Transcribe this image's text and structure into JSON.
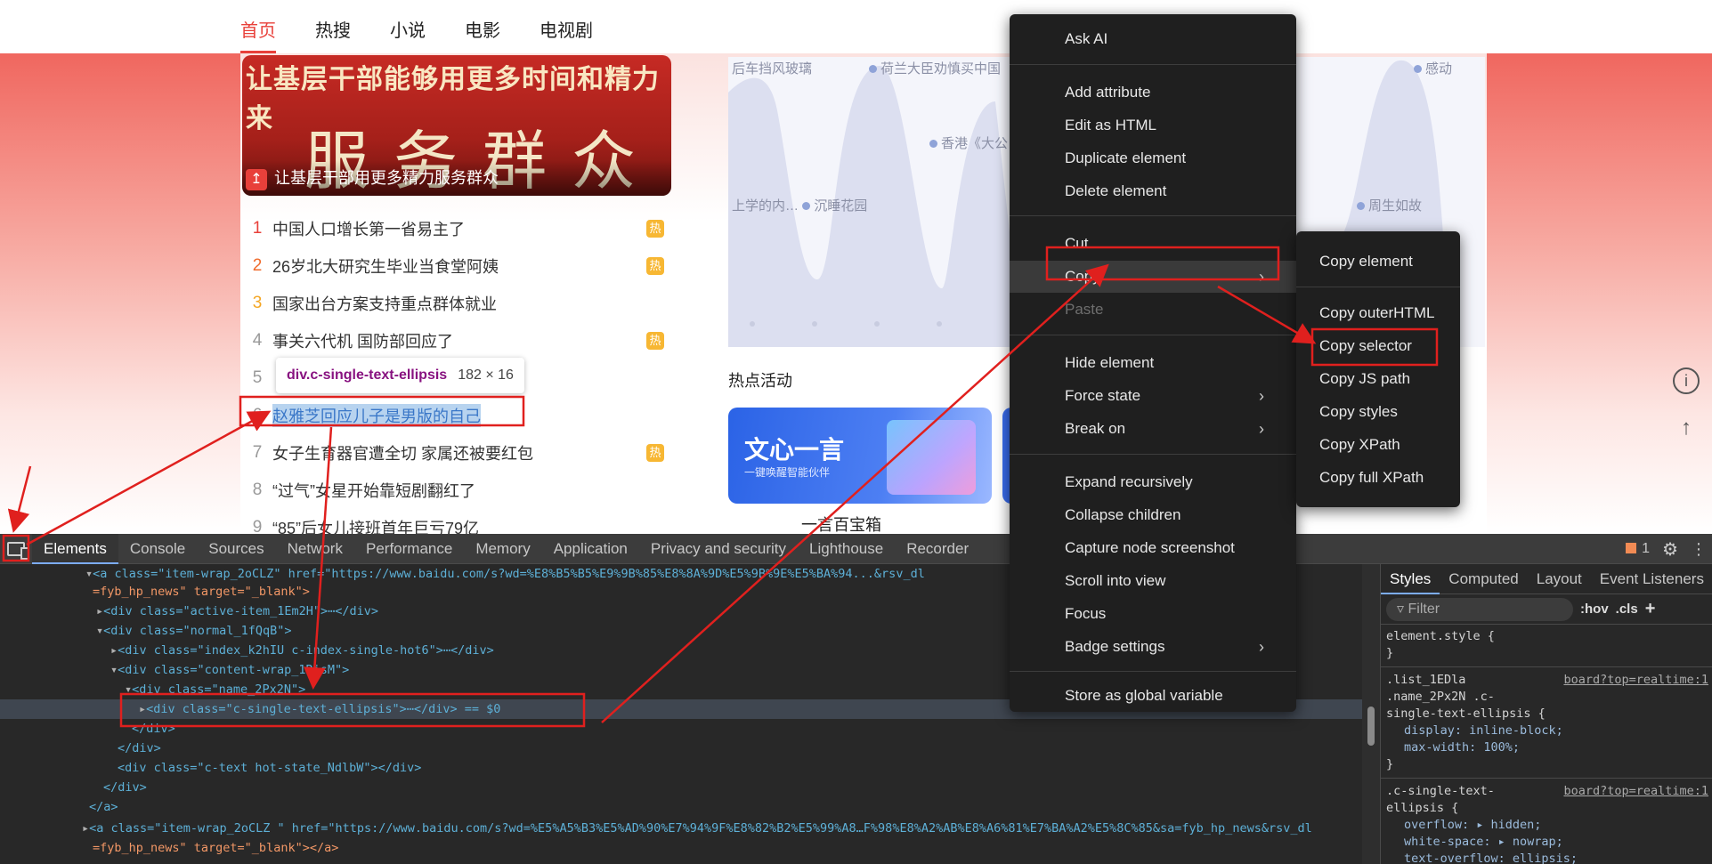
{
  "nav": {
    "tabs": [
      "首页",
      "热搜",
      "小说",
      "电影",
      "电视剧"
    ]
  },
  "hero": {
    "headline": "让基层干部能够用更多时间和精力来",
    "big_text": "服务群众",
    "caption": "让基层干部用更多精力服务群众"
  },
  "hot_list": [
    {
      "rank": "1",
      "title": "中国人口增长第一省易主了",
      "badge": "热"
    },
    {
      "rank": "2",
      "title": "26岁北大研究生毕业当食堂阿姨",
      "badge": "热"
    },
    {
      "rank": "3",
      "title": "国家出台方案支持重点群体就业",
      "badge": ""
    },
    {
      "rank": "4",
      "title": "事关六代机 国防部回应了",
      "badge": "热"
    },
    {
      "rank": "5",
      "title": "",
      "badge": ""
    },
    {
      "rank": "6",
      "title": "赵雅芝回应儿子是男版的自己",
      "badge": ""
    },
    {
      "rank": "7",
      "title": "女子生育器官遭全切 家属还被要红包",
      "badge": "热"
    },
    {
      "rank": "8",
      "title": "“过气”女星开始靠短剧翻红了",
      "badge": ""
    },
    {
      "rank": "9",
      "title": "“85”后女儿接班首年巨亏79亿",
      "badge": ""
    }
  ],
  "tooltip": {
    "selector": "div.c-single-text-ellipsis",
    "size": "182 × 16"
  },
  "chart_labels": [
    "后车挡风玻璃",
    "荷兰大臣劝慎买中国",
    "香港《大公",
    "上学的内…",
    "沉睡花园",
    "感动",
    "周生如故"
  ],
  "activity": {
    "section_title": "热点活动",
    "card_title": "文心一言",
    "card_subtitle": "一键唤醒智能伙伴",
    "card_caption": "一言百宝箱"
  },
  "devtools": {
    "tabs": [
      "Elements",
      "Console",
      "Sources",
      "Network",
      "Performance",
      "Memory",
      "Application",
      "Privacy and security",
      "Lighthouse",
      "Recorder"
    ],
    "issues_count": "1",
    "dom_lines": [
      {
        "a": "<a class=\"item-wrap_2oCLZ\" href=\"https://www.baidu.com/s?wd=%E8%B5%B5%E9%9B%85%E8%8A%9D%E5%9B%9E%E5%BA%94...&rsv_dl"
      },
      {
        "a": "=fyb_hp_news\" target=\"_blank\">"
      },
      {
        "a": "<div class=\"active-item_1Em2H\">⋯</div>"
      },
      {
        "a": "<div class=\"normal_1fQqB\">"
      },
      {
        "a": "<div class=\"index_k2hIU  c-index-single-hot6\">⋯</div>"
      },
      {
        "a": "<div class=\"content-wrap_1RisM\">"
      },
      {
        "a": "<div class=\"name_2Px2N\">"
      },
      {
        "a": "<div class=\"c-single-text-ellipsis\">⋯</div> == $0"
      },
      {
        "a": "</div>"
      },
      {
        "a": "</div>"
      },
      {
        "a": "<div class=\"c-text  hot-state_NdlbW\"></div>"
      },
      {
        "a": "</div>"
      },
      {
        "a": "</a>"
      },
      {
        "a": "<a class=\"item-wrap_2oCLZ \" href=\"https://www.baidu.com/s?wd=%E5%A5%B3%E5%AD%90%E7%94%9F%E8%82%B2%E5%99%A8…F%98%E8%A2%AB%E8%A6%81%E7%BA%A2%E5%8C%85&sa=fyb_hp_news&rsv_dl"
      },
      {
        "a": "=fyb_hp_news\" target=\"_blank\"></a>"
      }
    ],
    "styles": {
      "tabs": [
        "Styles",
        "Computed",
        "Layout",
        "Event Listeners"
      ],
      "filter_placeholder": "Filter",
      "hov": ":hov",
      "cls": ".cls",
      "rules": [
        "element.style {",
        "}",
        ".list_1EDla",
        ".name_2Px2N .c-",
        "single-text-ellipsis {",
        "display: inline-block;",
        "max-width: 100%;",
        "}",
        ".c-single-text-",
        "ellipsis {",
        "overflow: ▸ hidden;",
        "white-space: ▸ nowrap;",
        "text-overflow: ellipsis;"
      ],
      "source": "board?top=realtime:1"
    }
  },
  "context_menu": {
    "items": [
      {
        "label": "Ask AI"
      },
      {
        "label": "Add attribute"
      },
      {
        "label": "Edit as HTML"
      },
      {
        "label": "Duplicate element"
      },
      {
        "label": "Delete element"
      },
      {
        "label": "Cut"
      },
      {
        "label": "Copy"
      },
      {
        "label": "Paste"
      },
      {
        "label": "Hide element"
      },
      {
        "label": "Force state"
      },
      {
        "label": "Break on"
      },
      {
        "label": "Expand recursively"
      },
      {
        "label": "Collapse children"
      },
      {
        "label": "Capture node screenshot"
      },
      {
        "label": "Scroll into view"
      },
      {
        "label": "Focus"
      },
      {
        "label": "Badge settings"
      },
      {
        "label": "Store as global variable"
      }
    ],
    "submenu": [
      "Copy element",
      "Copy outerHTML",
      "Copy selector",
      "Copy JS path",
      "Copy styles",
      "Copy XPath",
      "Copy full XPath"
    ]
  },
  "colors": {
    "accent_red": "#e8403a",
    "annotation_red": "#e0201e",
    "devtools_bg": "#282828",
    "menu_bg": "#1f1f1f"
  }
}
